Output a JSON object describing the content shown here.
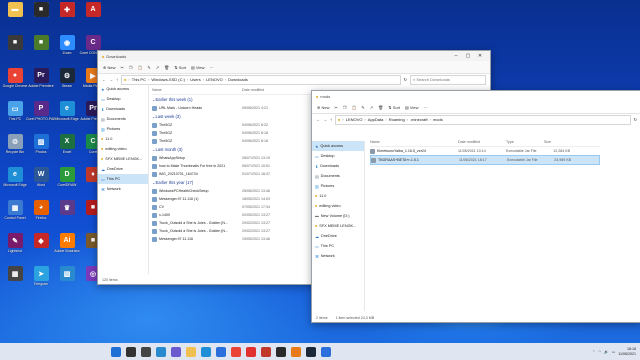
{
  "desktop": {
    "icons": [
      {
        "label": "",
        "color": "#2a6fdb",
        "glyph": "▣"
      },
      {
        "label": "",
        "color": "#1f8f3a",
        "glyph": "♜"
      },
      {
        "label": "",
        "color": "#ea4335",
        "glyph": "●"
      },
      {
        "label": "",
        "color": "#2b3b8f",
        "glyph": "Ps"
      },
      {
        "label": "",
        "color": "#3a3a3a",
        "glyph": "■"
      },
      {
        "label": "",
        "color": "#4a7a2a",
        "glyph": "■"
      },
      {
        "label": "Zoom",
        "color": "#2d8cff",
        "glyph": "◉"
      },
      {
        "label": "Corel CONNECT",
        "color": "#6a2a8a",
        "glyph": "C"
      },
      {
        "label": "Google Chrome",
        "color": "#ea4335",
        "glyph": "●"
      },
      {
        "label": "Adobe Premiere",
        "color": "#2a1a5a",
        "glyph": "Pr"
      },
      {
        "label": "Steam",
        "color": "#1b2838",
        "glyph": "⚙"
      },
      {
        "label": "Media Player",
        "color": "#e87a1a",
        "glyph": "▶"
      },
      {
        "label": "This PC",
        "color": "#4aa3e8",
        "glyph": "▭"
      },
      {
        "label": "Corel PHOTO-PAINT",
        "color": "#5a2a8a",
        "glyph": "P"
      },
      {
        "label": "Microsoft Edge",
        "color": "#1e8fd6",
        "glyph": "e"
      },
      {
        "label": "Adobe Premiere",
        "color": "#2a1a5a",
        "glyph": "Pr"
      },
      {
        "label": "Recycle Bin",
        "color": "#8aa0b8",
        "glyph": "♲"
      },
      {
        "label": "Photos",
        "color": "#1e6fd6",
        "glyph": "▨"
      },
      {
        "label": "Excel",
        "color": "#1d6f42",
        "glyph": "X"
      },
      {
        "label": "Corel",
        "color": "#1a8a4a",
        "glyph": "C"
      },
      {
        "label": "Microsoft Edge",
        "color": "#1e8fd6",
        "glyph": "e"
      },
      {
        "label": "Word",
        "color": "#2b5797",
        "glyph": "W"
      },
      {
        "label": "CorelDRAW",
        "color": "#2a9a3a",
        "glyph": "D"
      },
      {
        "label": "",
        "color": "#c0392b",
        "glyph": "♦"
      },
      {
        "label": "Control Panel",
        "color": "#3a7ad0",
        "glyph": "▦"
      },
      {
        "label": "Firefox",
        "color": "#e66000",
        "glyph": "◕"
      },
      {
        "label": "",
        "color": "#5a3a8a",
        "glyph": "♛"
      },
      {
        "label": "",
        "color": "#b71c1c",
        "glyph": "■"
      },
      {
        "label": "Lightshot",
        "color": "#7a1a6a",
        "glyph": "✎"
      },
      {
        "label": "",
        "color": "#c62828",
        "glyph": "◆"
      },
      {
        "label": "Adobe Illustrator",
        "color": "#ff7c00",
        "glyph": "Ai"
      },
      {
        "label": "",
        "color": "#7a5a2a",
        "glyph": "■"
      },
      {
        "label": "",
        "color": "#444",
        "glyph": "▦"
      },
      {
        "label": "Telegram",
        "color": "#2aa3e0",
        "glyph": "➤"
      },
      {
        "label": "",
        "color": "#2a8ad0",
        "glyph": "▧"
      },
      {
        "label": "",
        "color": "#7a3aba",
        "glyph": "◎"
      },
      {
        "label": "",
        "color": "#2a2a2a",
        "glyph": "◐"
      },
      {
        "label": "",
        "color": "#e0e0e0",
        "glyph": "▯"
      },
      {
        "label": "",
        "color": "#e0e0e0",
        "glyph": "▯"
      },
      {
        "label": "",
        "color": "#c62828",
        "glyph": "A"
      },
      {
        "label": "",
        "color": "#f0c050",
        "glyph": "▬"
      },
      {
        "label": "",
        "color": "#2a2a2a",
        "glyph": "■"
      },
      {
        "label": "",
        "color": "#c62828",
        "glyph": "✚"
      }
    ]
  },
  "window_downloads": {
    "title": "Downloads",
    "toolbar": [
      "New",
      "Sort",
      "View"
    ],
    "address": [
      "This PC",
      "Windows-SSD (C:)",
      "Users",
      "LENOVO",
      "Downloads"
    ],
    "search_placeholder": "Search Downloads",
    "columns": [
      "Name",
      "Date modified",
      "Type",
      "Size"
    ],
    "nav": [
      "Quick access",
      "Desktop",
      "Downloads",
      "Documents",
      "Pictures",
      "11.0",
      "editing video",
      "SFX MEME LENGK...",
      "OneDrive",
      "This PC",
      "Network"
    ],
    "groups": [
      {
        "name": "Earlier this week (1)",
        "items": [
          {
            "name": "URL Mark - Unicorn Heads",
            "date": "09/06/2021 4:21"
          }
        ]
      },
      {
        "name": "Last week (3)",
        "items": [
          {
            "name": "The5GZ",
            "date": "04/06/2021 6:22"
          },
          {
            "name": "The5GZ",
            "date": "04/06/2021 6:18"
          },
          {
            "name": "The5GZ",
            "date": "04/06/2021 6:16"
          }
        ]
      },
      {
        "name": "Last month (3)",
        "items": [
          {
            "name": "WhatsAppSetup",
            "date": "26/07/2021 13:19"
          },
          {
            "name": "how to Make Thumbnails For free in 2021",
            "date": "06/07/2021 10:51"
          },
          {
            "name": "IMG_20210701_164734",
            "date": "01/07/2021 16:47"
          }
        ]
      },
      {
        "name": "Earlier this year (17)",
        "items": [
          {
            "name": "WindowsPCHealthCheckSetup",
            "date": "25/06/2021 13:46"
          },
          {
            "name": "Messenger.97.11.116 (1)",
            "date": "18/05/2021 14:03"
          },
          {
            "name": "CV",
            "date": "07/05/2021 17:34"
          },
          {
            "name": "x-1400",
            "date": "02/05/2021 13:27"
          },
          {
            "name": "Truck_Outsold a She is Jules - Golden [N...",
            "date": "29/02/2021 13:27"
          },
          {
            "name": "Truck_Outsold a She is Jules - Golden [N...",
            "date": "29/02/2021 13:27"
          },
          {
            "name": "Messenger.97.11.116",
            "date": "19/05/2021 13:46"
          }
        ]
      }
    ],
    "status": "120 items"
  },
  "window_mods": {
    "title": "mods",
    "toolbar": [
      "New",
      "Sort",
      "View"
    ],
    "address": [
      "LENOVO",
      "AppData",
      "Roaming",
      ".minecraft",
      "mods"
    ],
    "columns": [
      "Name",
      "Date modified",
      "Type",
      "Size"
    ],
    "nav": [
      "Quick access",
      "Desktop",
      "Downloads",
      "Documents",
      "Pictures",
      "11.0",
      "editing video",
      "New Volume (D:)",
      "SFX MEME LENGK...",
      "OneDrive",
      "This PC",
      "Network"
    ],
    "files": [
      {
        "name": "KimetsunoYaiba_1.16.5_ver24",
        "date": "11/05/2021 10:14",
        "type": "Executable Jar File",
        "size": "12,284 KB",
        "selected": false
      },
      {
        "name": "TBGRAAS+BETA+r-1.5.1",
        "date": "11/06/2021 18:17",
        "type": "Executable Jar File",
        "size": "24,989 KB",
        "selected": true
      }
    ],
    "status_count": "2 items",
    "status_sel": "1 item selected  24,3 MB"
  },
  "taskbar": {
    "icons": [
      {
        "name": "start",
        "color": "#1e6fd6"
      },
      {
        "name": "search",
        "color": "#333333"
      },
      {
        "name": "taskview",
        "color": "#444444"
      },
      {
        "name": "widgets",
        "color": "#2a8ad0"
      },
      {
        "name": "chat",
        "color": "#6a5acd"
      },
      {
        "name": "explorer",
        "color": "#f0c050"
      },
      {
        "name": "edge",
        "color": "#1e8fd6"
      },
      {
        "name": "store",
        "color": "#2a6fdb"
      },
      {
        "name": "chrome",
        "color": "#ea4335"
      },
      {
        "name": "mail",
        "color": "#e03030"
      },
      {
        "name": "app",
        "color": "#c0392b"
      },
      {
        "name": "app2",
        "color": "#2a2a2a"
      },
      {
        "name": "app3",
        "color": "#e87a1a"
      },
      {
        "name": "app4",
        "color": "#1b2838"
      },
      {
        "name": "app5",
        "color": "#2a6fdb"
      }
    ],
    "time": "18:18",
    "date": "11/06/2021"
  }
}
